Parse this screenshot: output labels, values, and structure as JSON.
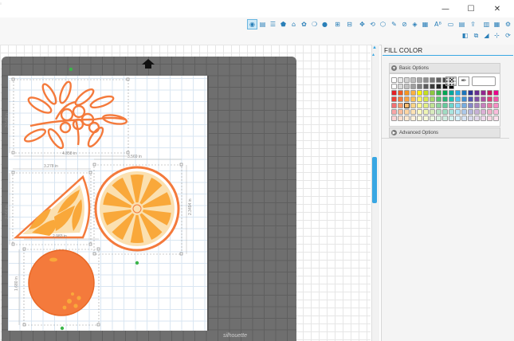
{
  "window": {
    "minimize": "—",
    "maximize": "☐",
    "close": "✕"
  },
  "toolbar": {
    "tools_row1": [
      "fill-color",
      "line-color",
      "line-style",
      "fill-pattern",
      "shape",
      "text-style",
      "image-effects",
      "transform",
      "replicate",
      "offset",
      "trace",
      "knife",
      "eraser",
      "modify",
      "page-setup",
      "library",
      "send",
      "store",
      "design",
      "help-a",
      "help-b"
    ],
    "text_tool_label": "Aᴮ"
  },
  "panel": {
    "title": "FILL COLOR",
    "basic_options": "Basic Options",
    "advanced_options": "Advanced Options",
    "accent": "#39a7e3",
    "swatch_rows": [
      [
        "#ffffff",
        "#e9e9e9",
        "#d3d3d3",
        "#bdbdbd",
        "#a6a6a6",
        "#8f8f8f",
        "#787878",
        "#616161",
        "#4a4a4a",
        "#333333"
      ],
      [
        "#ffffff",
        "#d9d9d9",
        "#c0c0c0",
        "#a0a0a0",
        "#808080",
        "#5c5c5c",
        "#3c3c3c",
        "#262626",
        "#111111",
        "#000000"
      ],
      [
        "#e31f26",
        "#f15a24",
        "#f7941e",
        "#fbb040",
        "#fff200",
        "#c4df1e",
        "#8dc63f",
        "#39b54a",
        "#00a651",
        "#00a99d",
        "#27aae1",
        "#1c75bc",
        "#2e3192",
        "#662d91",
        "#92278f",
        "#c2185b",
        "#ec008c"
      ],
      [
        "#ef4136",
        "#f47a3c",
        "#f9a23f",
        "#fcc159",
        "#fff568",
        "#d7e84b",
        "#a8d66a",
        "#5cc071",
        "#29b473",
        "#20c2b4",
        "#4fc3f2",
        "#3f8fd2",
        "#5557b0",
        "#8051a4",
        "#ad4fa2",
        "#d8407a",
        "#f256a8"
      ],
      [
        "#f37074",
        "#f79a6a",
        "#fbbb6f",
        "#fdd487",
        "#fff795",
        "#e3ef85",
        "#c0e194",
        "#8bd19d",
        "#66c99d",
        "#6dd4cb",
        "#85d5f5",
        "#77acdf",
        "#8587c7",
        "#a483bd",
        "#c680bd",
        "#e37ca3",
        "#f78dc4"
      ],
      [
        "#f8a5a7",
        "#fabd9c",
        "#fdd5a2",
        "#fee3b4",
        "#fffac0",
        "#eff5b4",
        "#d7ebbd",
        "#b7e2c3",
        "#a1dcc3",
        "#a8e4de",
        "#b4e5f8",
        "#adc9ea",
        "#b4b5dc",
        "#c7b1d6",
        "#dcb1d6",
        "#efafc7",
        "#fbbcdc"
      ],
      [
        "#fcd5d6",
        "#fde0d0",
        "#feead2",
        "#fff1da",
        "#fffcdf",
        "#f7fadb",
        "#ebf5df",
        "#dcf1e2",
        "#d1eee2",
        "#d4f2ef",
        "#daf2fc",
        "#d7e5f5",
        "#dadbee",
        "#e3d9ec",
        "#eed9ec",
        "#f7d8e4",
        "#fde0ee"
      ]
    ]
  },
  "canvas": {
    "dim_labels": [
      "4.858 in",
      "3.278 in",
      "3.569 in",
      "3.569 in",
      "2.966 in",
      "2.983 in",
      "1.680 in",
      "2.3494 in"
    ],
    "orange_color": "#f47a3c",
    "orange_fill": "#f9a83a",
    "watermark": "silhouette"
  }
}
